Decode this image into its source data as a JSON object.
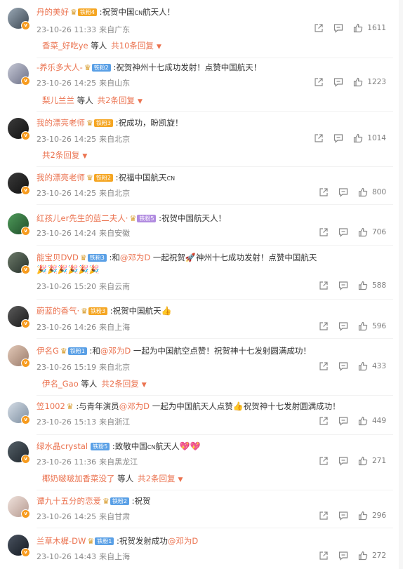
{
  "comments": [
    {
      "username": "丹的美好",
      "fan_badge": "铁粉4",
      "text": ":祝贺中国",
      "cn": "CN",
      "text2": "航天人！",
      "date": "23-10-26 11:33",
      "location": "来自广东",
      "likes": "1611",
      "reply": {
        "name": "香菜_好吃ye",
        "suffix": "等人",
        "count": "共10条回复"
      }
    },
    {
      "username": "-养乐多大人-",
      "fan_badge": "铁粉2",
      "text": ":祝贺神州十七成功发射！点赞中国航天！",
      "date": "23-10-26 14:25",
      "location": "来自山东",
      "likes": "1223",
      "reply": {
        "name": "梨儿兰兰",
        "suffix": "等人",
        "count": "共2条回复"
      }
    },
    {
      "username": "我的漂亮老师",
      "fan_badge": "铁粉3",
      "text": ":祝成功，盼凯旋！",
      "date": "23-10-26 14:25",
      "location": "来自北京",
      "likes": "1014",
      "reply": {
        "name": "",
        "suffix": "",
        "count": "共2条回复"
      }
    },
    {
      "username": "我的漂亮老师",
      "fan_badge": "铁粉2",
      "text": ":祝福中国航天",
      "cn": "CN",
      "date": "23-10-26 14:25",
      "location": "来自北京",
      "likes": "800"
    },
    {
      "username": "红孩儿er先生的蓝二夫人·",
      "fan_badge": "铁粉5",
      "text": ":祝贺中国航天人！",
      "date": "23-10-26 14:24",
      "location": "来自安徽",
      "likes": "706"
    },
    {
      "username": "能宝贝DVD",
      "fan_badge": "铁粉3",
      "text": ":和",
      "mention": "@邓为D",
      "text2": " 一起祝贺",
      "text3": "神州十七成功发射！点赞中国航天",
      "date": "23-10-26 15:20",
      "location": "来自云南",
      "likes": "588"
    },
    {
      "username": "蔚蓝的香气·",
      "fan_badge": "铁粉3",
      "text": ":祝贺中国航天",
      "date": "23-10-26 14:26",
      "location": "来自上海",
      "likes": "596"
    },
    {
      "username": "伊名G",
      "fan_badge": "铁粉1",
      "text": ":和",
      "mention": "@邓为D",
      "text2": " 一起为中国航空点赞！祝贺神十七发射圆满成功！",
      "date": "23-10-26 15:19",
      "location": "来自北京",
      "likes": "433",
      "reply": {
        "name": "伊名_Gao",
        "suffix": "等人",
        "count": "共2条回复"
      }
    },
    {
      "username": "笠1002",
      "text": ":与青年演员",
      "mention": "@邓为D",
      "text2": " 一起为中国航天人点赞",
      "text3": "祝贺神十七发射圆满成功！",
      "date": "23-10-26 15:13",
      "location": "来自浙江",
      "likes": "449"
    },
    {
      "username": "绿水晶crystal",
      "fan_badge": "铁粉5",
      "text": ":致敬中国",
      "cn": "CN",
      "text2": "航天人",
      "date": "23-10-26 11:36",
      "location": "来自黑龙江",
      "likes": "271",
      "reply": {
        "name": "椰奶啵啵加香菜没了",
        "suffix": "等人",
        "count": "共2条回复"
      }
    },
    {
      "username": "谭九十五分的恋爱",
      "fan_badge": "铁粉2",
      "text": ":祝贺",
      "date": "23-10-26 14:25",
      "location": "来自甘肃",
      "likes": "296"
    },
    {
      "username": "兰草木樨-DW",
      "fan_badge": "铁粉1",
      "text": ":祝贺发射成功",
      "mention": "@邓为D",
      "date": "23-10-26 14:43",
      "location": "来自上海",
      "likes": "272"
    }
  ],
  "colors": {
    "username": "#eb7350",
    "meta": "#888888",
    "accent": "#f79b1e"
  }
}
